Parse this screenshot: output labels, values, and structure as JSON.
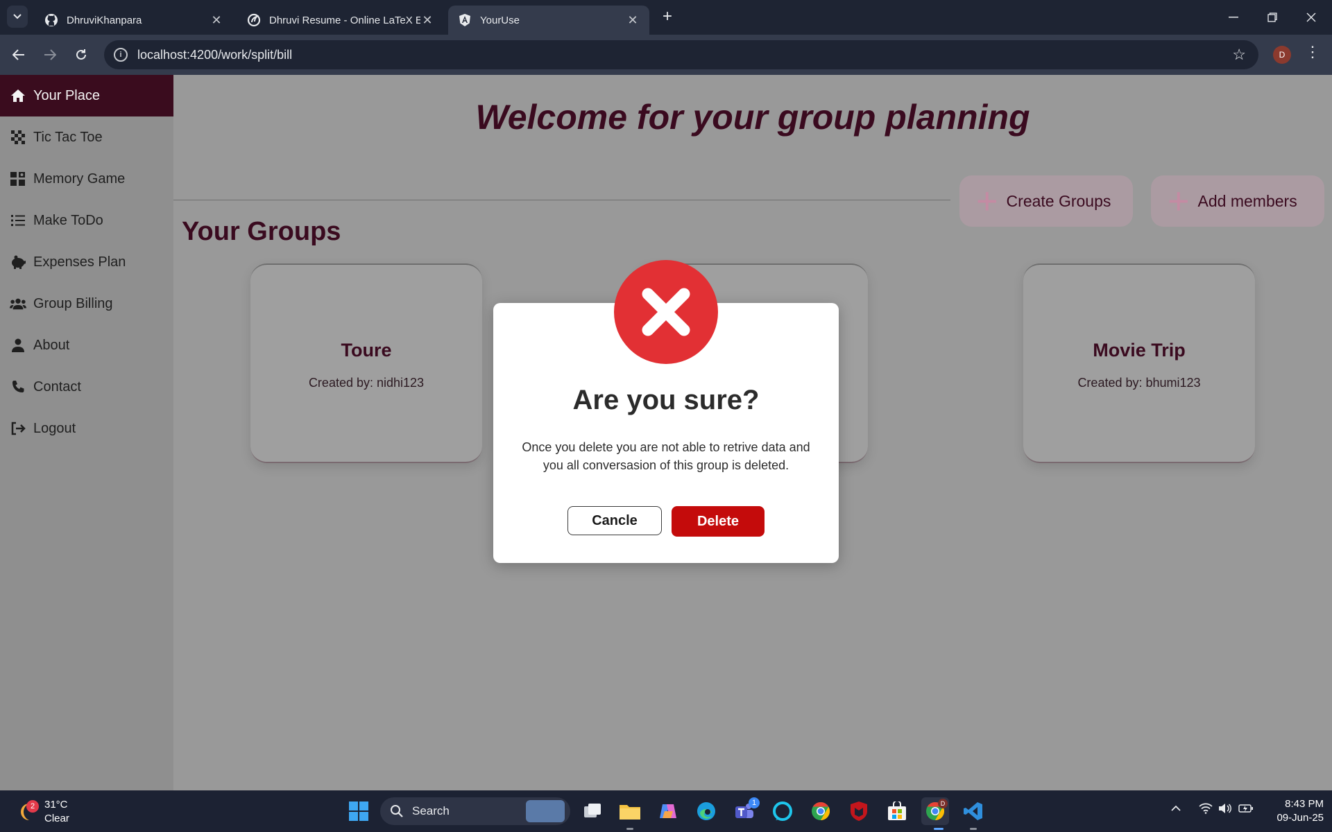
{
  "browser": {
    "tabs": [
      {
        "title": "DhruviKhanpara",
        "icon": "github-icon"
      },
      {
        "title": "Dhruvi Resume - Online LaTeX Editor",
        "icon": "overleaf-icon"
      },
      {
        "title": "YourUse",
        "icon": "angular-icon",
        "active": true
      }
    ],
    "url": "localhost:4200/work/split/bill",
    "profile_initial": "D"
  },
  "sidebar": {
    "items": [
      {
        "label": "Your Place",
        "icon": "home-icon",
        "active": true
      },
      {
        "label": "Tic Tac Toe",
        "icon": "grid-icon"
      },
      {
        "label": "Memory Game",
        "icon": "puzzle-icon"
      },
      {
        "label": "Make ToDo",
        "icon": "list-icon"
      },
      {
        "label": "Expenses Plan",
        "icon": "piggy-bank-icon"
      },
      {
        "label": "Group Billing",
        "icon": "users-icon"
      },
      {
        "label": "About",
        "icon": "user-icon"
      },
      {
        "label": "Contact",
        "icon": "phone-icon"
      },
      {
        "label": "Logout",
        "icon": "logout-icon"
      }
    ]
  },
  "main": {
    "title": "Welcome for your group planning",
    "create_groups_label": "Create Groups",
    "add_members_label": "Add members",
    "groups_title": "Your Groups",
    "groups": [
      {
        "name": "Toure",
        "created_by": "Created by: nidhi123"
      },
      {
        "name": "Movie Trip",
        "created_by": "Created by: bhumi123"
      }
    ]
  },
  "modal": {
    "title": "Are you sure?",
    "message": "Once you delete you are not able to retrive data and you all conversasion of this group is deleted.",
    "cancel_label": "Cancle",
    "delete_label": "Delete"
  },
  "taskbar": {
    "weather_temp": "31°C",
    "weather_cond": "Clear",
    "weather_badge": "2",
    "search_label": "Search",
    "teams_badge": "1",
    "time": "8:43 PM",
    "date": "09-Jun-25"
  },
  "colors": {
    "accent": "#3a0c1e",
    "danger": "#c40b0b",
    "error_icon": "#e23034"
  }
}
